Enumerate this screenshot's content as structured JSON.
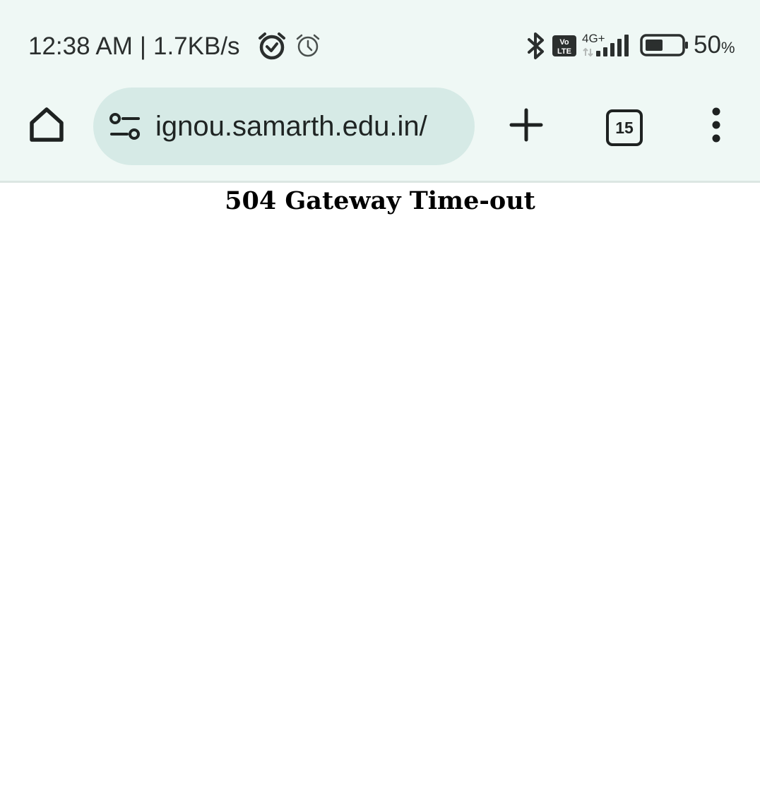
{
  "status_bar": {
    "time": "12:38 AM",
    "separator": "|",
    "net_speed": "1.7KB/s",
    "network_type": "4G+",
    "volte_line1": "Vo",
    "volte_line2": "LTE",
    "battery_level": 50,
    "battery_percent": "50",
    "percent_symbol": "%",
    "icons": [
      "alarm-clock-icon",
      "alarm-icon",
      "bluetooth-icon",
      "volte-icon",
      "signal-icon",
      "battery-icon"
    ]
  },
  "toolbar": {
    "url": "ignou.samarth.edu.in/",
    "tab_count": "15",
    "icons": [
      "home-icon",
      "site-settings-icon",
      "new-tab-icon",
      "tab-switcher-icon",
      "more-menu-icon"
    ]
  },
  "page": {
    "heading": "504 Gateway Time-out"
  },
  "colors": {
    "chrome_bg": "#eff8f5",
    "omnibox_bg": "#d6eae6",
    "icon_color": "#1e2221",
    "page_bg": "#ffffff"
  }
}
